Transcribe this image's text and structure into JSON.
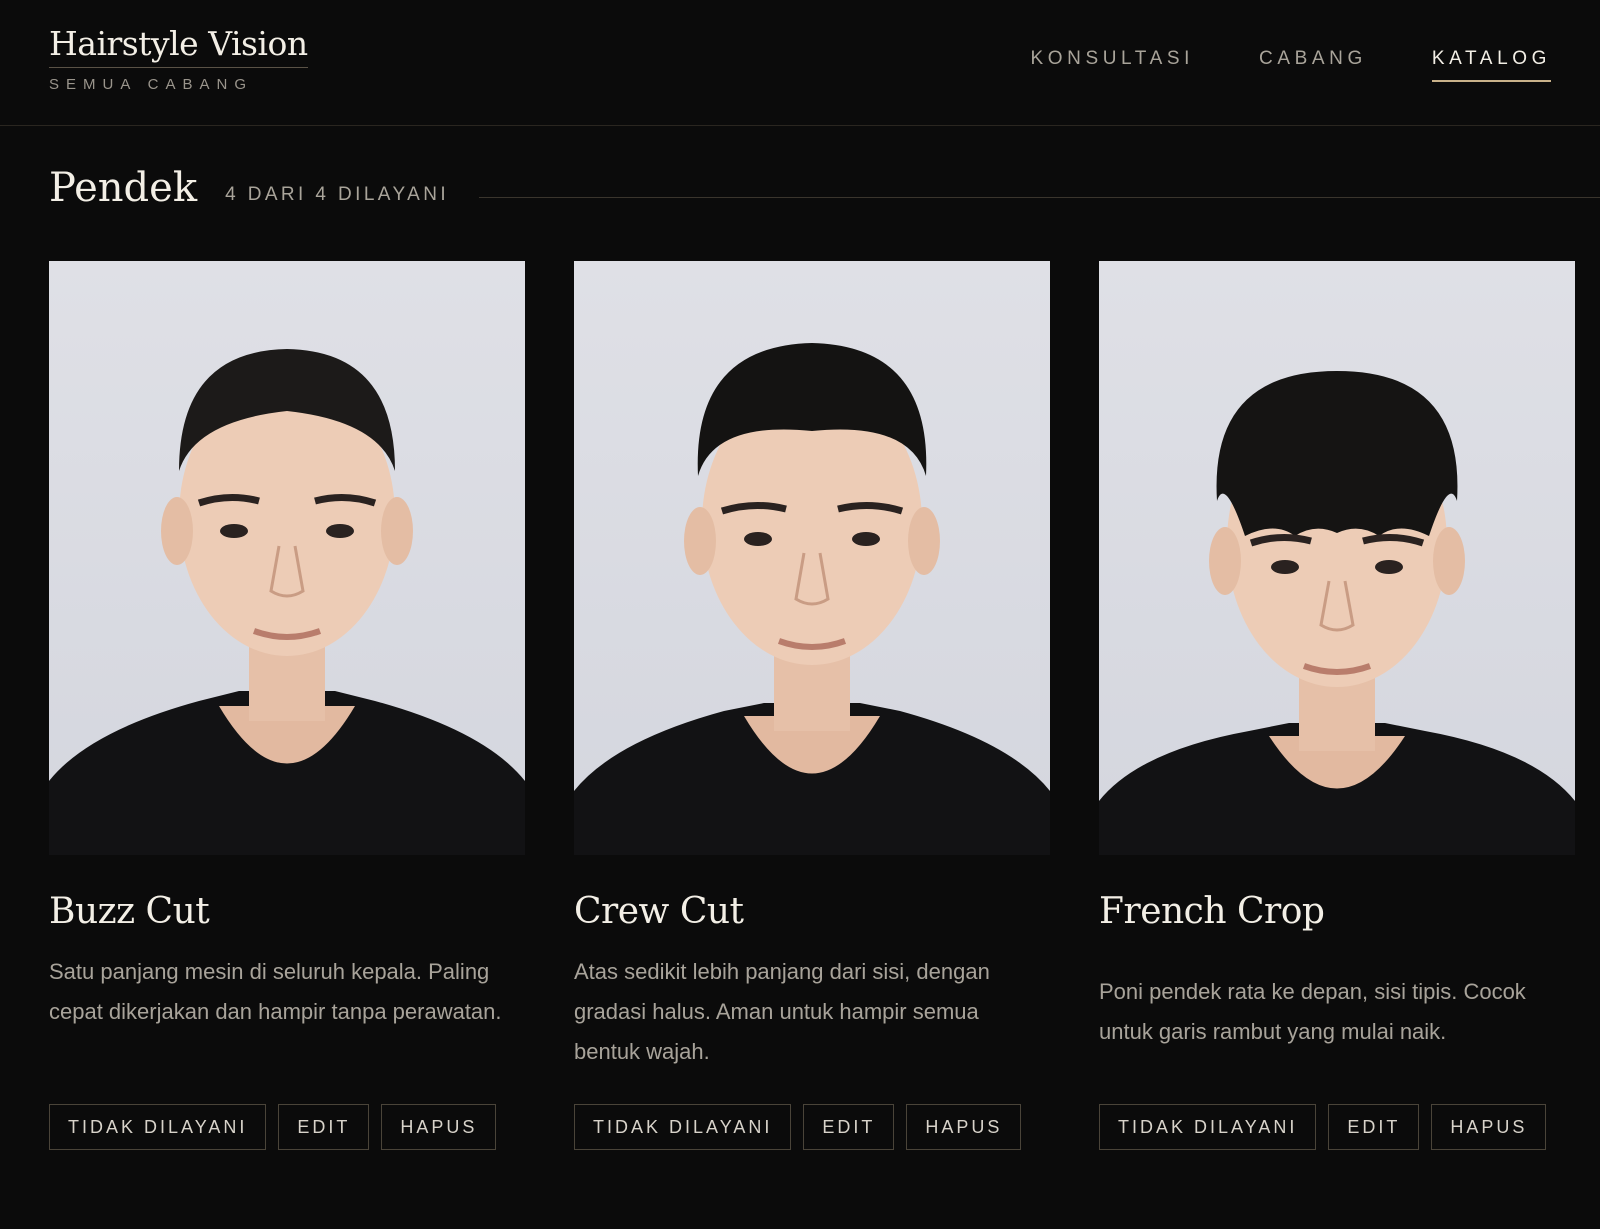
{
  "brand": {
    "title": "Hairstyle Vision",
    "subtitle": "SEMUA CABANG"
  },
  "nav": {
    "items": [
      {
        "label": "KONSULTASI",
        "active": false
      },
      {
        "label": "CABANG",
        "active": false
      },
      {
        "label": "KATALOG",
        "active": true
      }
    ]
  },
  "section": {
    "title": "Pendek",
    "count": "4 DARI 4 DILAYANI"
  },
  "cards": [
    {
      "title": "Buzz Cut",
      "description": "Satu panjang mesin di seluruh kepala. Paling cepat dikerjakan dan hampir tanpa perawatan.",
      "photo_icon": "buzz-cut-portrait",
      "actions": {
        "toggle": "TIDAK DILAYANI",
        "edit": "EDIT",
        "delete": "HAPUS"
      }
    },
    {
      "title": "Crew Cut",
      "description": "Atas sedikit lebih panjang dari sisi, dengan gradasi halus. Aman untuk hampir semua bentuk wajah.",
      "photo_icon": "crew-cut-portrait",
      "actions": {
        "toggle": "TIDAK DILAYANI",
        "edit": "EDIT",
        "delete": "HAPUS"
      }
    },
    {
      "title": "French Crop",
      "description": "Poni pendek rata ke depan, sisi tipis. Cocok untuk garis rambut yang mulai naik.",
      "photo_icon": "french-crop-portrait",
      "actions": {
        "toggle": "TIDAK DILAYANI",
        "edit": "EDIT",
        "delete": "HAPUS"
      }
    }
  ],
  "colors": {
    "background": "#0b0b0b",
    "accent": "#c9b28a",
    "text": "#f3efe6",
    "muted": "#a8a39a",
    "button_border": "#4a4439"
  }
}
